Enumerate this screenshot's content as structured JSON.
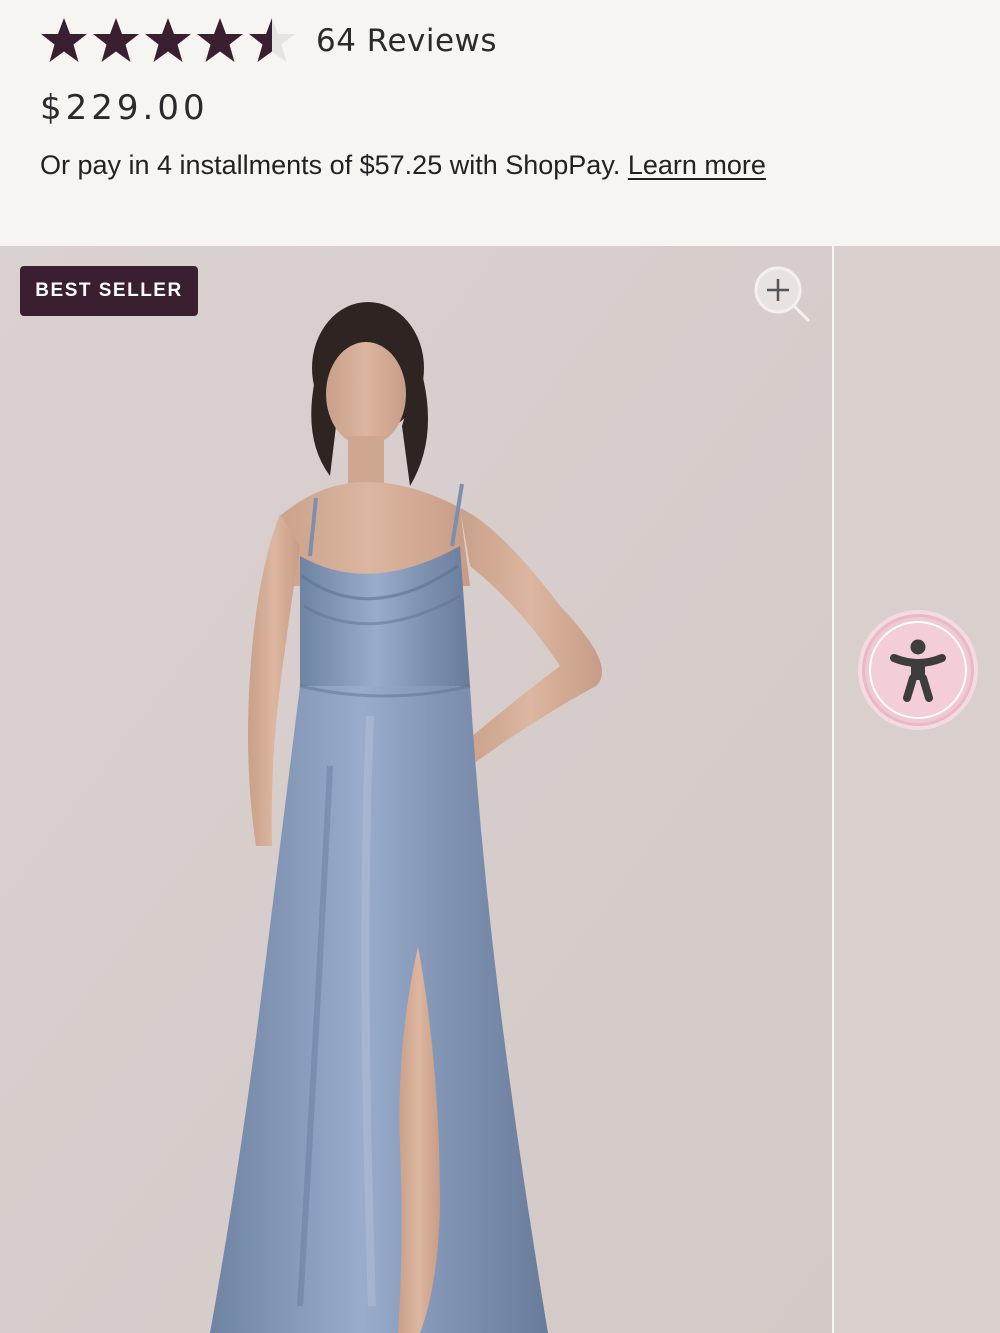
{
  "rating": {
    "value": 4.5,
    "max": 5,
    "reviews_label": "64 Reviews",
    "star_color": "#3a1f30",
    "star_empty_color": "#e6e4e2"
  },
  "price": "$229.00",
  "installments": {
    "text": "Or pay in 4 installments of $57.25 with ShopPay.",
    "link_label": "Learn more"
  },
  "gallery": {
    "badge": "BEST SELLER",
    "zoom_icon": "zoom-in-icon",
    "photo_alt": "Model wearing a slate blue satin cowl-neck slip gown with a front slit"
  },
  "accessibility_button": {
    "icon": "accessibility-person-icon",
    "color": "#f1c9d3"
  }
}
